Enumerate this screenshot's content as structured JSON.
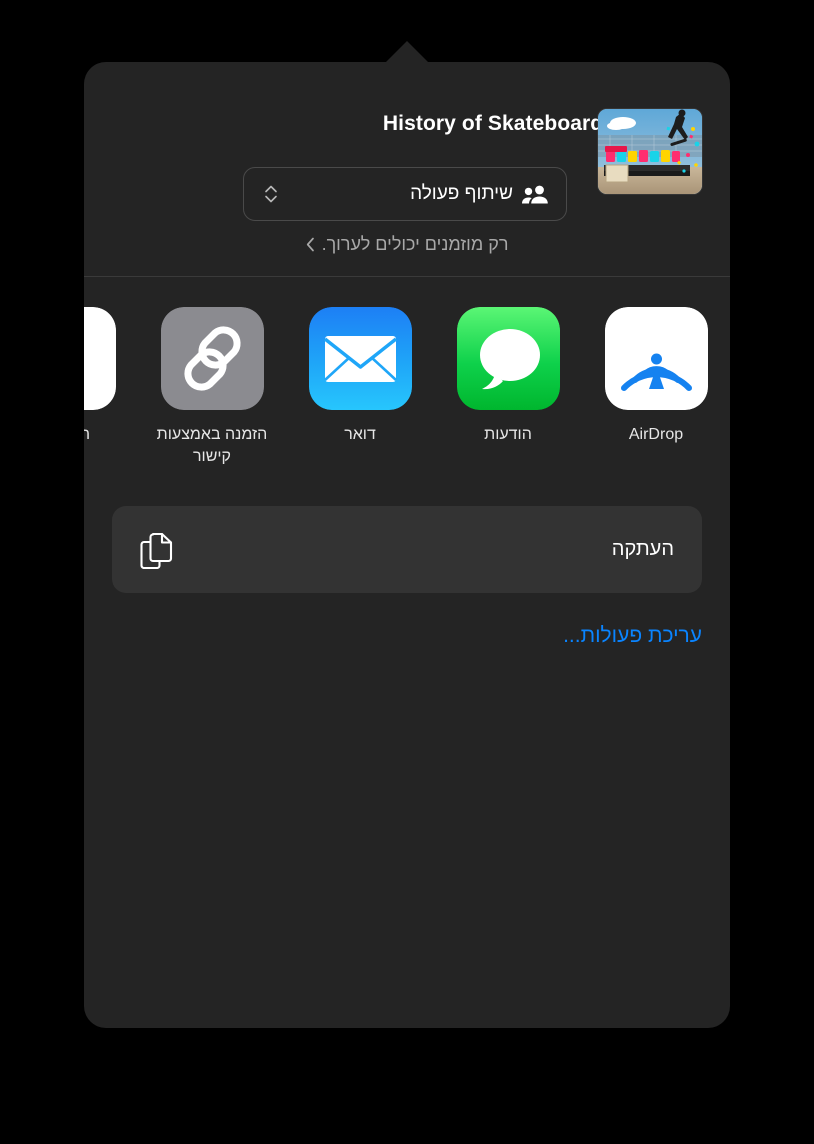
{
  "sheet": {
    "document_title": "History of Skateboards",
    "thumbnail_name": "skateboard-photo-thumbnail",
    "collaborate": {
      "label": "שיתוף פעולה",
      "people_icon": "people-icon",
      "stepper_icon": "up-down-chevron-icon"
    },
    "permissions": {
      "text": "רק מוזמנים יכולים לערוך.",
      "chevron_icon": "chevron-left-icon"
    }
  },
  "apps": [
    {
      "label": "AirDrop",
      "icon": "airdrop-icon"
    },
    {
      "label": "הודעות",
      "icon": "messages-icon"
    },
    {
      "label": "דואר",
      "icon": "mail-icon"
    },
    {
      "label": "הזמנה באמצעות קישור",
      "icon": "link-icon"
    },
    {
      "label": "תזכורות",
      "icon": "reminders-icon"
    }
  ],
  "actions": [
    {
      "label": "העתקה",
      "icon": "copy-icon"
    }
  ],
  "edit_actions": {
    "label": "עריכת פעולות..."
  },
  "colors": {
    "panel": "#242424",
    "action_row": "#333333",
    "accent_blue": "#0a84ff",
    "divider": "#3a3a3a",
    "secondary_text": "#a8a8a8"
  }
}
